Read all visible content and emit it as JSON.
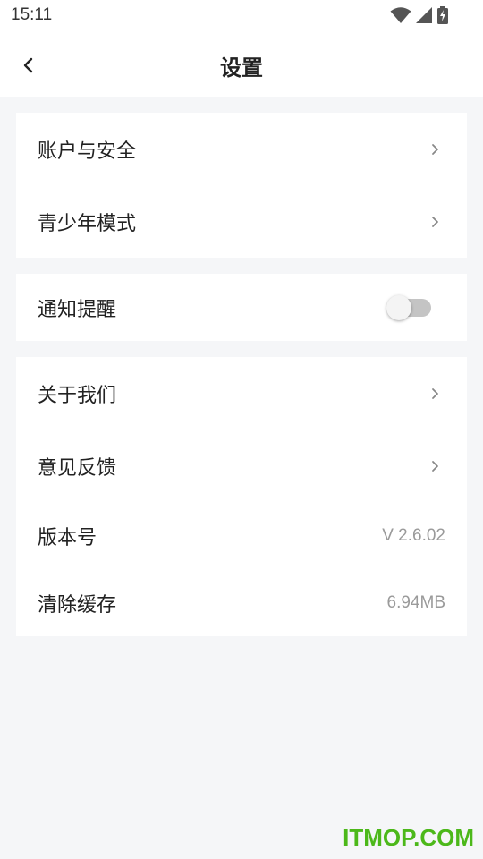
{
  "status_bar": {
    "time": "15:11",
    "icons": [
      "wifi-icon",
      "signal-icon",
      "battery-charging-icon"
    ]
  },
  "header": {
    "back_icon": "chevron-left-icon",
    "title": "设置"
  },
  "groups": [
    {
      "items": [
        {
          "label": "账户与安全",
          "type": "link"
        },
        {
          "label": "青少年模式",
          "type": "link"
        }
      ]
    },
    {
      "items": [
        {
          "label": "通知提醒",
          "type": "toggle",
          "enabled": false
        }
      ]
    },
    {
      "items": [
        {
          "label": "关于我们",
          "type": "link"
        },
        {
          "label": "意见反馈",
          "type": "link"
        },
        {
          "label": "版本号",
          "type": "value",
          "value": "V 2.6.02"
        },
        {
          "label": "清除缓存",
          "type": "value",
          "value": "6.94MB"
        }
      ]
    }
  ],
  "watermark": "ITMOP.COM",
  "colors": {
    "background": "#f5f6f8",
    "card": "#ffffff",
    "text": "#222222",
    "secondary_text": "#9a9a9a",
    "toggle_off": "#c4c4c4",
    "watermark": "#4cb81a"
  }
}
